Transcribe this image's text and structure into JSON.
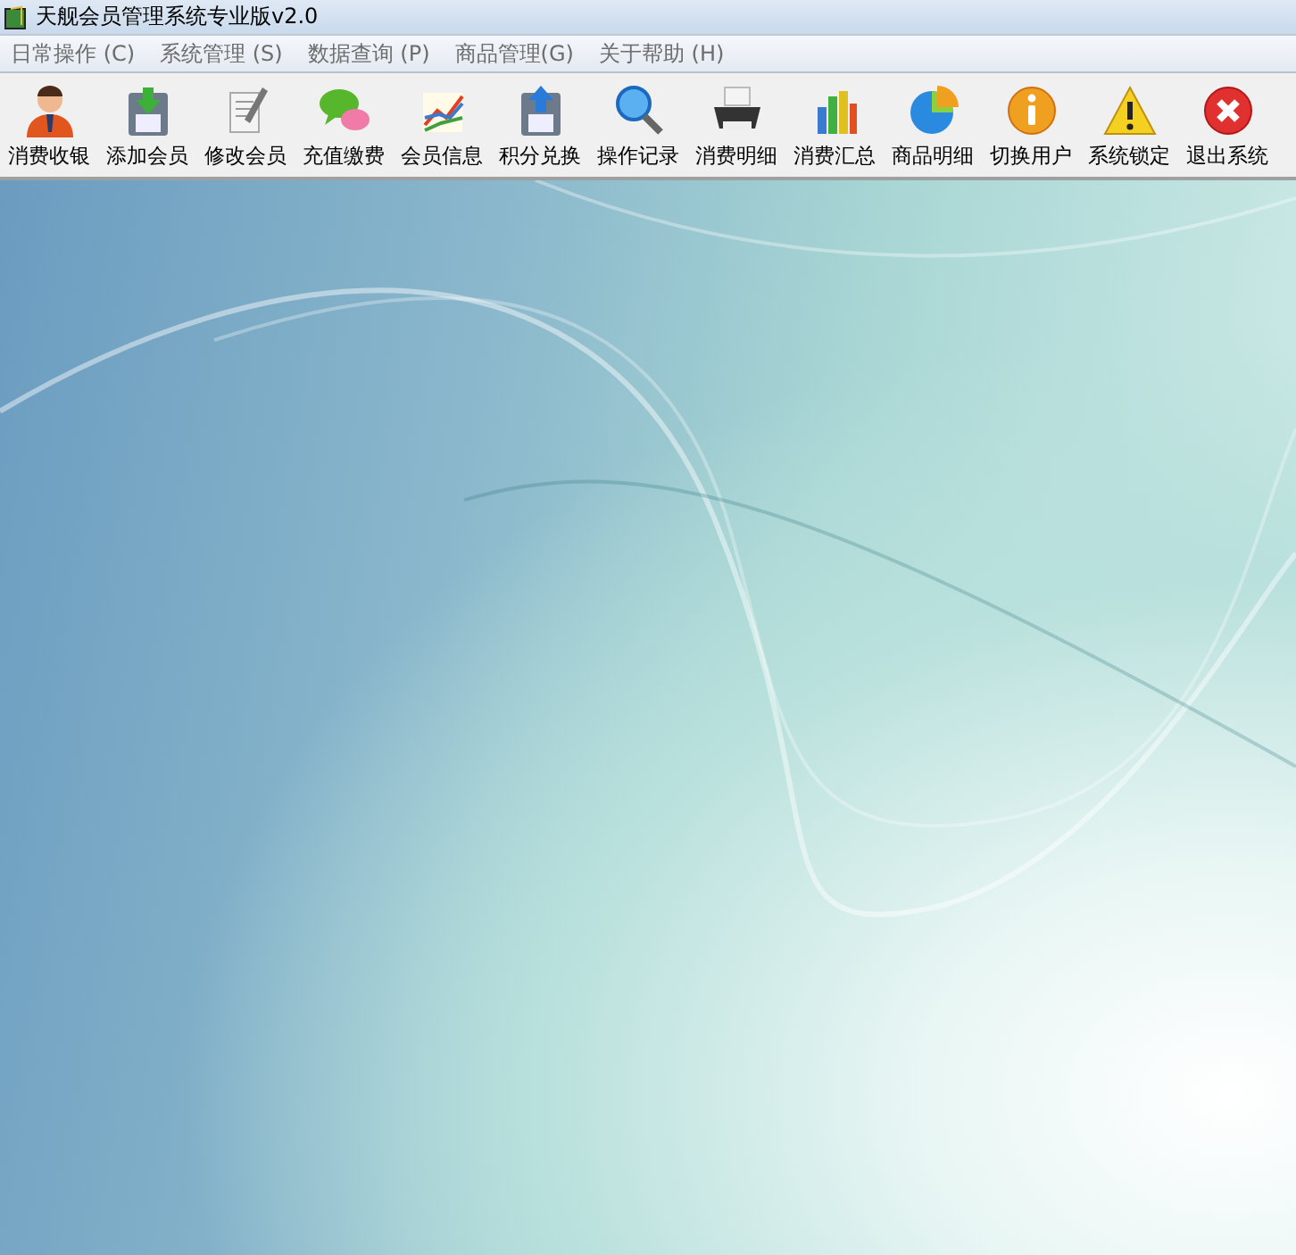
{
  "window": {
    "title": "天舰会员管理系统专业版v2.0"
  },
  "menu": [
    {
      "label": "日常操作 (C)"
    },
    {
      "label": "系统管理 (S)"
    },
    {
      "label": "数据查询 (P)"
    },
    {
      "label": "商品管理(G)"
    },
    {
      "label": "关于帮助 (H)"
    }
  ],
  "toolbar": [
    {
      "label": "消费收银"
    },
    {
      "label": "添加会员"
    },
    {
      "label": "修改会员"
    },
    {
      "label": "充值缴费"
    },
    {
      "label": "会员信息"
    },
    {
      "label": "积分兑换"
    },
    {
      "label": "操作记录"
    },
    {
      "label": "消费明细"
    },
    {
      "label": "消费汇总"
    },
    {
      "label": "商品明细"
    },
    {
      "label": "切换用户"
    },
    {
      "label": "系统锁定"
    },
    {
      "label": "退出系统"
    }
  ]
}
